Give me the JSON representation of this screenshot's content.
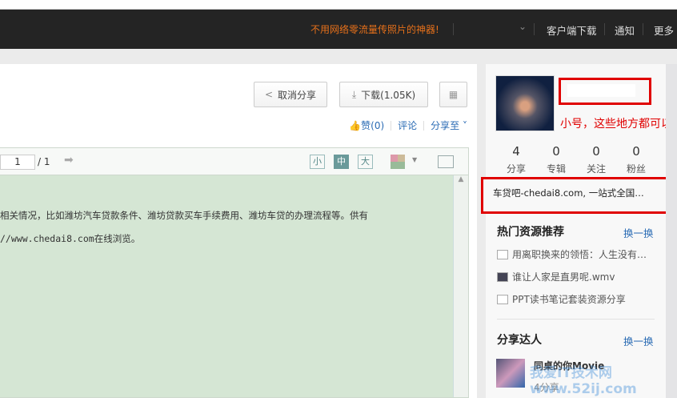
{
  "nav": {
    "promo": "不用网络零流量传照片的神器!",
    "items": [
      "客户端下载",
      "通知",
      "更多"
    ]
  },
  "toolbar": {
    "unshare": "取消分享",
    "download": "下载(1.05K)",
    "like": "赞(0)",
    "comment": "评论",
    "share_to": "分享至"
  },
  "viewer": {
    "page": "1",
    "total": "/ 1",
    "sizes": [
      "小",
      "中",
      "大"
    ],
    "lines": [
      "相关情况，比如潍坊汽车贷款条件、潍坊贷款买车手续费用、潍坊车贷的办理流程等。供有",
      "//www.chedai8.com在线浏览。"
    ]
  },
  "sidebar": {
    "annotation": "小号，这些地方都可以用。",
    "stats": [
      {
        "n": "4",
        "l": "分享"
      },
      {
        "n": "0",
        "l": "专辑"
      },
      {
        "n": "0",
        "l": "关注"
      },
      {
        "n": "0",
        "l": "粉丝"
      }
    ],
    "bio": "车贷吧-chedai8.com, 一站式全国…",
    "hot": {
      "title": "热门资源推荐",
      "refresh": "换一换",
      "items": [
        {
          "t": "用离职换来的领悟：人生没有…",
          "icon": "document-icon"
        },
        {
          "t": "谁让人家是直男呢.wmv",
          "icon": "video-icon"
        },
        {
          "t": "PPT读书笔记套装资源分享",
          "icon": "document-icon"
        }
      ]
    },
    "experts": {
      "title": "分享达人",
      "refresh": "换一换",
      "name": "同桌的你Movie",
      "count": "4分享"
    },
    "watermark": "我爱IT技术网 www.52ij.com"
  },
  "colors": {
    "nav_bg": "#242424",
    "promo": "#e6701a",
    "link": "#2a6bb4",
    "annotation": "#e00000",
    "doc_bg": "#d5e6d4"
  }
}
